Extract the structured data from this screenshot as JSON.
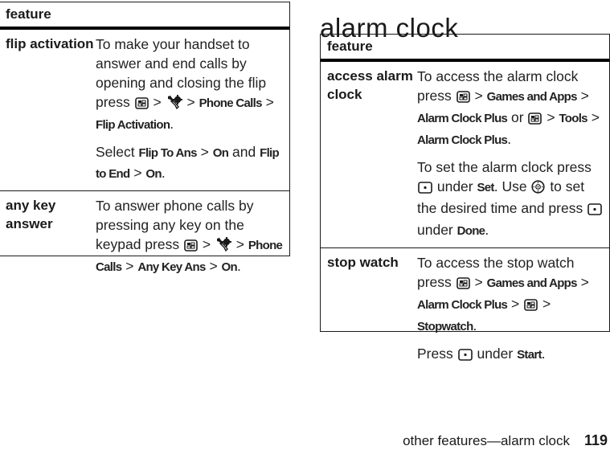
{
  "left_table": {
    "header": "feature",
    "rows": [
      {
        "name": "flip activation",
        "paragraphs": [
          [
            {
              "t": "text",
              "v": "To make your handset to answer and end calls by opening and closing the flip press "
            },
            {
              "t": "icon",
              "v": "menu-key-icon"
            },
            {
              "t": "text",
              "v": " > "
            },
            {
              "t": "icon",
              "v": "settings-icon"
            },
            {
              "t": "text",
              "v": " > "
            },
            {
              "t": "key",
              "v": "Phone Calls"
            },
            {
              "t": "text",
              "v": " > "
            },
            {
              "t": "key",
              "v": "Flip Activation"
            },
            {
              "t": "text",
              "v": "."
            }
          ],
          [
            {
              "t": "text",
              "v": "Select "
            },
            {
              "t": "key",
              "v": "Flip To Ans"
            },
            {
              "t": "text",
              "v": " > "
            },
            {
              "t": "key",
              "v": "On"
            },
            {
              "t": "text",
              "v": " and "
            },
            {
              "t": "key",
              "v": "Flip to End"
            },
            {
              "t": "text",
              "v": " > "
            },
            {
              "t": "key",
              "v": "On"
            },
            {
              "t": "text",
              "v": "."
            }
          ]
        ]
      },
      {
        "name": "any key answer",
        "paragraphs": [
          [
            {
              "t": "text",
              "v": "To answer phone calls by pressing any key on the keypad press "
            },
            {
              "t": "icon",
              "v": "menu-key-icon"
            },
            {
              "t": "text",
              "v": " > "
            },
            {
              "t": "icon",
              "v": "settings-icon"
            },
            {
              "t": "text",
              "v": " > "
            },
            {
              "t": "key",
              "v": "Phone Calls"
            },
            {
              "t": "text",
              "v": " > "
            },
            {
              "t": "key",
              "v": "Any Key Ans"
            },
            {
              "t": "text",
              "v": " > "
            },
            {
              "t": "key",
              "v": "On"
            },
            {
              "t": "text",
              "v": "."
            }
          ]
        ]
      }
    ]
  },
  "section_title": "alarm clock",
  "right_table": {
    "header": "feature",
    "rows": [
      {
        "name": "access alarm clock",
        "paragraphs": [
          [
            {
              "t": "text",
              "v": "To access the alarm clock press "
            },
            {
              "t": "icon",
              "v": "menu-key-icon"
            },
            {
              "t": "text",
              "v": " > "
            },
            {
              "t": "key",
              "v": "Games and Apps"
            },
            {
              "t": "text",
              "v": " > "
            },
            {
              "t": "key",
              "v": "Alarm Clock Plus"
            },
            {
              "t": "text",
              "v": " or "
            },
            {
              "t": "icon",
              "v": "menu-key-icon"
            },
            {
              "t": "text",
              "v": " > "
            },
            {
              "t": "key",
              "v": "Tools"
            },
            {
              "t": "text",
              "v": " > "
            },
            {
              "t": "key",
              "v": "Alarm Clock Plus"
            },
            {
              "t": "text",
              "v": "."
            }
          ],
          [
            {
              "t": "text",
              "v": "To set the alarm clock press "
            },
            {
              "t": "icon",
              "v": "soft-key-icon"
            },
            {
              "t": "text",
              "v": " under "
            },
            {
              "t": "key",
              "v": "Set"
            },
            {
              "t": "text",
              "v": ". Use "
            },
            {
              "t": "icon",
              "v": "nav-key-icon"
            },
            {
              "t": "text",
              "v": " to set the desired time and press "
            },
            {
              "t": "icon",
              "v": "soft-key-icon"
            },
            {
              "t": "text",
              "v": " under "
            },
            {
              "t": "key",
              "v": "Done"
            },
            {
              "t": "text",
              "v": "."
            }
          ]
        ]
      },
      {
        "name": "stop watch",
        "paragraphs": [
          [
            {
              "t": "text",
              "v": "To access the stop watch press "
            },
            {
              "t": "icon",
              "v": "menu-key-icon"
            },
            {
              "t": "text",
              "v": " > "
            },
            {
              "t": "key",
              "v": "Games and Apps"
            },
            {
              "t": "text",
              "v": " > "
            },
            {
              "t": "key",
              "v": "Alarm Clock Plus"
            },
            {
              "t": "text",
              "v": " > "
            },
            {
              "t": "icon",
              "v": "menu-key-icon"
            },
            {
              "t": "text",
              "v": "  > "
            },
            {
              "t": "key",
              "v": "Stopwatch"
            },
            {
              "t": "text",
              "v": "."
            }
          ],
          [
            {
              "t": "text",
              "v": "Press "
            },
            {
              "t": "icon",
              "v": "soft-key-icon"
            },
            {
              "t": "text",
              "v": " under "
            },
            {
              "t": "key",
              "v": "Start"
            },
            {
              "t": "text",
              "v": "."
            }
          ]
        ]
      }
    ]
  },
  "footer": {
    "section": "other features—alarm clock",
    "page_number": "119"
  }
}
